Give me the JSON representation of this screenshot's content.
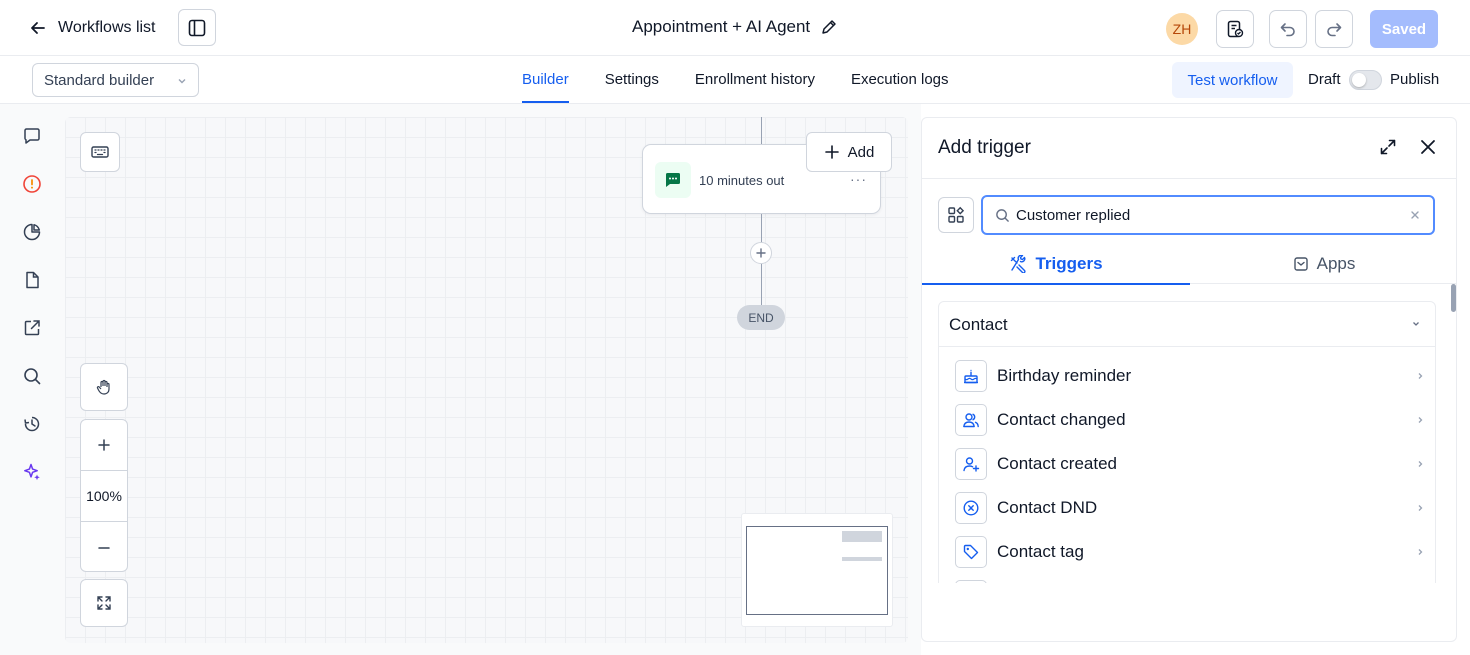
{
  "header": {
    "back_label": "Workflows list",
    "workflow_title": "Appointment + AI Agent",
    "avatar_initials": "ZH",
    "saved_label": "Saved"
  },
  "subbar": {
    "builder_mode": "Standard builder",
    "tabs": [
      {
        "label": "Builder",
        "active": true
      },
      {
        "label": "Settings",
        "active": false
      },
      {
        "label": "Enrollment history",
        "active": false
      },
      {
        "label": "Execution logs",
        "active": false
      }
    ],
    "test_workflow_label": "Test workflow",
    "draft_label": "Draft",
    "publish_label": "Publish",
    "publish_enabled": false
  },
  "rail": {
    "icons": [
      "chat-icon",
      "alert-circle-icon",
      "pie-chart-icon",
      "document-icon",
      "external-link-icon",
      "search-icon",
      "history-icon",
      "sparkle-icon"
    ]
  },
  "canvas": {
    "zoom_level": "100%",
    "node_label": "10 minutes out",
    "node_more": "···",
    "add_label": "Add",
    "end_label": "END"
  },
  "panel": {
    "title": "Add trigger",
    "search_value": "Customer replied",
    "tabs": [
      {
        "label": "Triggers",
        "active": true
      },
      {
        "label": "Apps",
        "active": false
      }
    ],
    "group_title": "Contact",
    "items": [
      {
        "label": "Birthday reminder",
        "icon": "cake-icon"
      },
      {
        "label": "Contact changed",
        "icon": "users-icon"
      },
      {
        "label": "Contact created",
        "icon": "user-plus-icon"
      },
      {
        "label": "Contact DND",
        "icon": "x-circle-icon"
      },
      {
        "label": "Contact tag",
        "icon": "tag-icon"
      }
    ]
  },
  "colors": {
    "accent": "#155eef",
    "saved_button": "#a4bcfd",
    "avatar_bg": "#fcd9a6",
    "node_icon": "#067647"
  }
}
